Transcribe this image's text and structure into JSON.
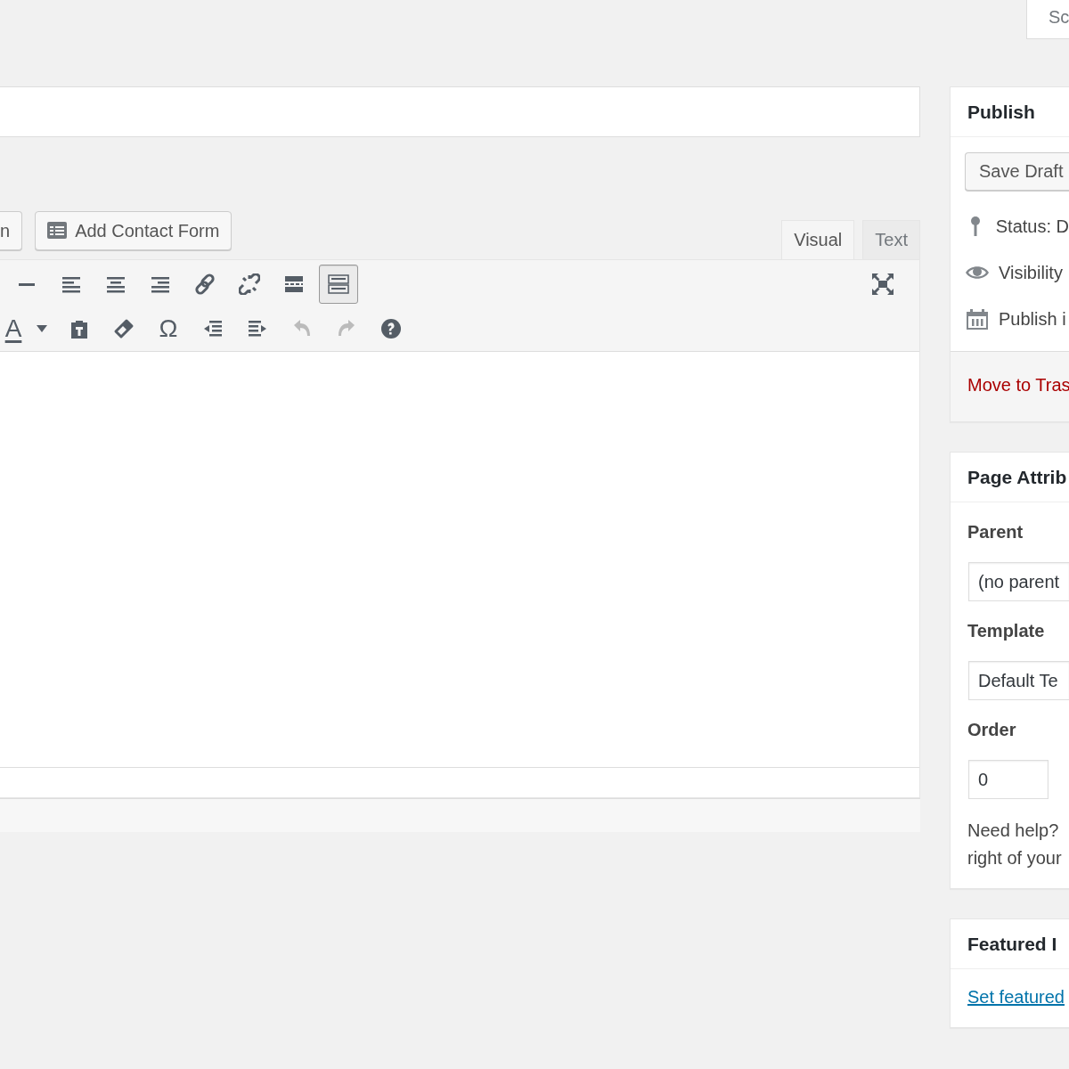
{
  "screen_options": {
    "label": "Sc"
  },
  "media_buttons": [
    {
      "kind": "plain",
      "label": "n"
    },
    {
      "kind": "form",
      "label": "Add Contact Form"
    }
  ],
  "editor_tabs": [
    {
      "label": "Visual",
      "selected": true
    },
    {
      "label": "Text",
      "selected": false
    }
  ],
  "toolbar_rows": [
    [
      {
        "kind": "hr",
        "active": false,
        "disabled": false
      },
      {
        "kind": "align-left",
        "active": false,
        "disabled": false
      },
      {
        "kind": "align-center",
        "active": false,
        "disabled": false
      },
      {
        "kind": "align-right",
        "active": false,
        "disabled": false
      },
      {
        "kind": "link",
        "active": false,
        "disabled": false
      },
      {
        "kind": "unlink",
        "active": false,
        "disabled": false
      },
      {
        "kind": "more",
        "active": false,
        "disabled": false
      },
      {
        "kind": "toolbar-toggle",
        "active": true,
        "disabled": false
      }
    ],
    [
      {
        "kind": "text-color",
        "label": "A",
        "active": false,
        "disabled": false
      },
      {
        "kind": "caret",
        "active": false,
        "disabled": false
      },
      {
        "kind": "paste-text",
        "active": false,
        "disabled": false
      },
      {
        "kind": "eraser",
        "active": false,
        "disabled": false
      },
      {
        "kind": "special-char",
        "label": "Ω",
        "active": false,
        "disabled": false
      },
      {
        "kind": "outdent",
        "active": false,
        "disabled": false
      },
      {
        "kind": "indent",
        "active": false,
        "disabled": false
      },
      {
        "kind": "undo",
        "active": false,
        "disabled": true
      },
      {
        "kind": "redo",
        "active": false,
        "disabled": true
      },
      {
        "kind": "help",
        "active": false,
        "disabled": false
      }
    ]
  ],
  "publish": {
    "title": "Publish",
    "save_button": "Save Draft",
    "items": [
      {
        "kind": "pin",
        "label": "Status: D"
      },
      {
        "kind": "eye",
        "label": "Visibility"
      },
      {
        "kind": "calendar",
        "label": "Publish i"
      }
    ],
    "trash_link": "Move to Tras"
  },
  "page_attributes": {
    "title": "Page Attrib",
    "parent_label": "Parent",
    "parent_value": "(no parent",
    "template_label": "Template",
    "template_value": "Default Te",
    "order_label": "Order",
    "order_value": "0",
    "help_lines": [
      "Need help?",
      "right of your"
    ]
  },
  "featured_image": {
    "title": "Featured I",
    "link": "Set featured"
  }
}
